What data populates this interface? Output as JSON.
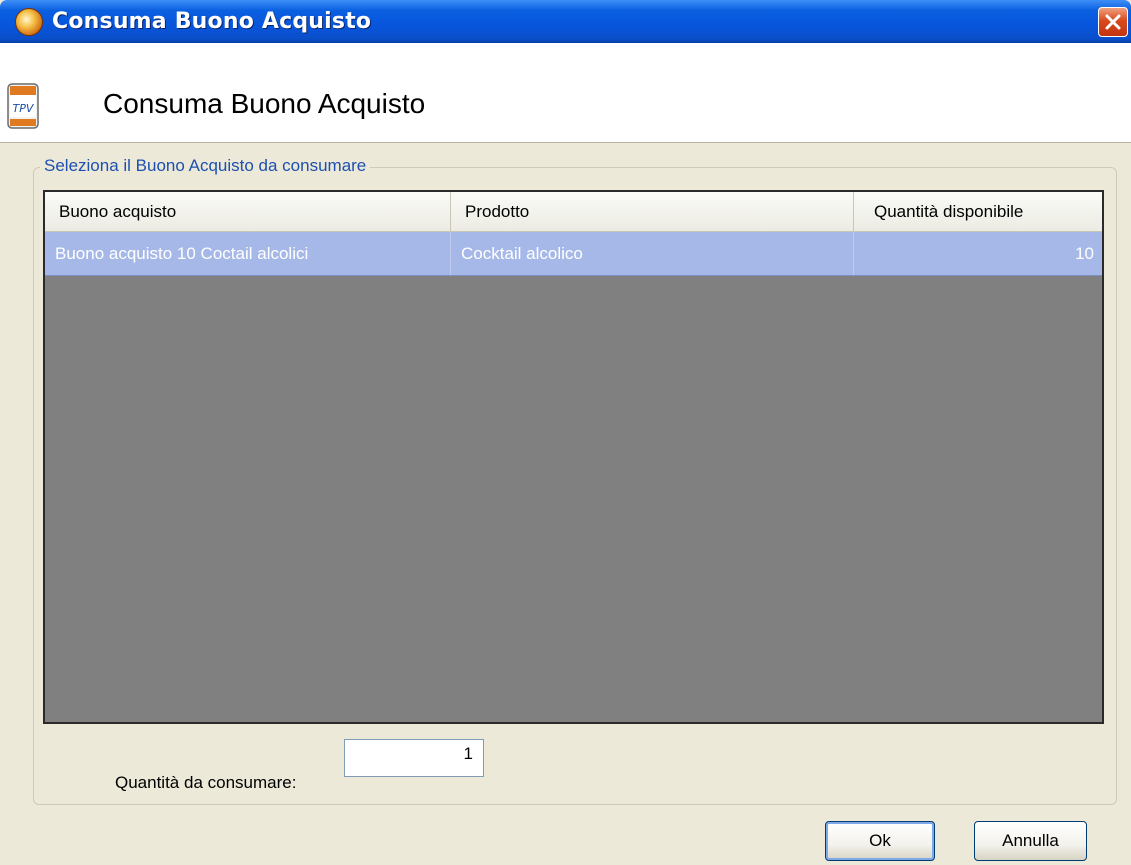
{
  "window": {
    "title": "Consuma Buono Acquisto",
    "close_icon": "close-icon"
  },
  "header": {
    "icon_text": "TPV",
    "title": "Consuma Buono Acquisto"
  },
  "group": {
    "legend": "Seleziona il Buono Acquisto da consumare"
  },
  "grid": {
    "columns": [
      "Buono acquisto",
      "Prodotto",
      "Quantità disponibile"
    ],
    "rows": [
      {
        "buono": "Buono acquisto 10 Coctail alcolici",
        "prodotto": "Cocktail alcolico",
        "quantita": "10",
        "selected": true
      }
    ],
    "selection_color": "#a6b8e8",
    "empty_area_color": "#808080"
  },
  "quantity": {
    "label": "Quantità da consumare:",
    "value": "1"
  },
  "buttons": {
    "ok": "Ok",
    "cancel": "Annulla"
  }
}
